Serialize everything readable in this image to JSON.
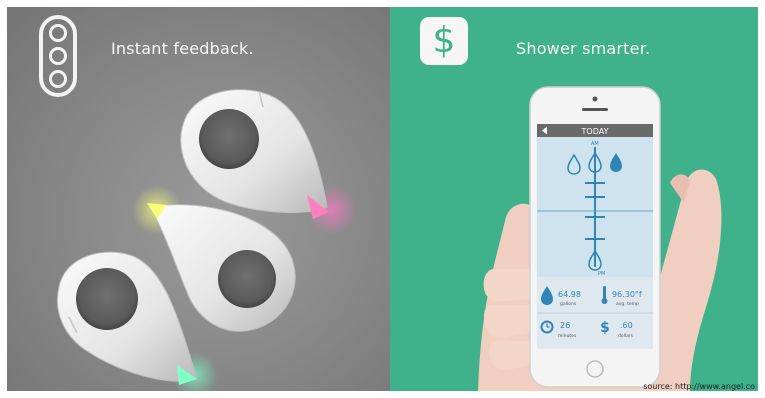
{
  "left_panel": {
    "caption": "Instant feedback.",
    "icon": "traffic-light-icon",
    "background_color": "#8a8a8a"
  },
  "right_panel": {
    "caption": "Shower smarter.",
    "icon": "dollar-icon",
    "icon_symbol": "$",
    "background_color": "#3fb28c"
  },
  "phone": {
    "header": "TODAY",
    "axis_top": "AM",
    "axis_bottom": "PM",
    "stats": {
      "gallons_value": "64.98",
      "gallons_label": "gallons",
      "temp_value": "96.30°f",
      "temp_label": "avg. temp",
      "minutes_value": "26",
      "minutes_label": "minutes",
      "dollars_value": ".60",
      "dollars_label": "dollars",
      "dollar_symbol": "$"
    }
  },
  "source_text": "source: http://www.angel.co"
}
